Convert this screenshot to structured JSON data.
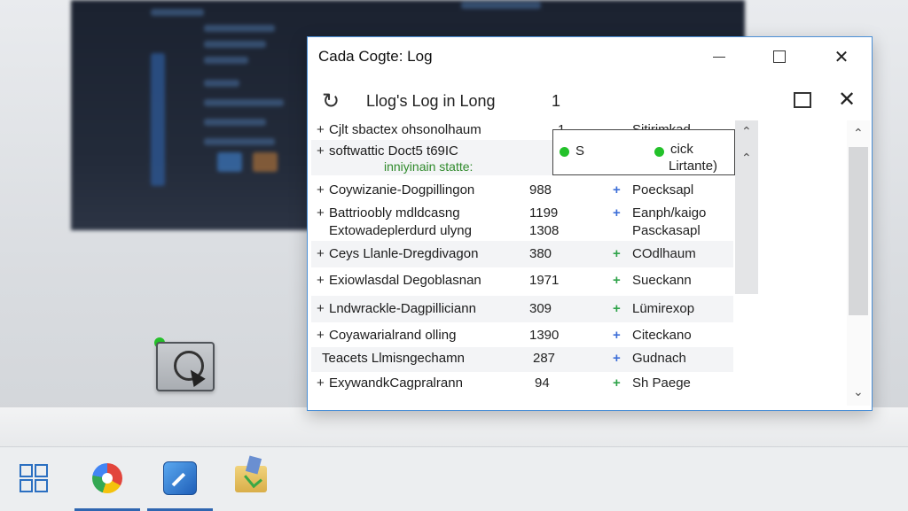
{
  "window": {
    "title": "Cada Cogte: Log",
    "controls": {
      "minimize": "—",
      "maximize": "☐",
      "close": "✕"
    }
  },
  "toolbar": {
    "refresh_icon": "↻",
    "title": "Llog's Log in Long",
    "count": "1",
    "close_icon": "✕"
  },
  "rows": [
    {
      "plus": "+",
      "name": "Cjlt sbactex ohsonolhaum",
      "count": "1",
      "mark": "",
      "status": "Sitirimkad"
    },
    {
      "plus": "+",
      "name": "softwattic Doct5 t69IC",
      "note": "inniyinain statte:",
      "count": "",
      "mark": "",
      "status": ""
    },
    {
      "plus": "+",
      "name": "Coywizanie-Dogpillingon",
      "count": "988",
      "mark": "+",
      "mark_color": "#3e6fd8",
      "status": "Poecksapl"
    },
    {
      "plus": "+",
      "name": "Battrioobly mdldcasng",
      "name2": "Extowadeplerdurd ulyng",
      "count": "1199",
      "count2": "1308",
      "mark": "+",
      "mark_color": "#3e6fd8",
      "status": "Eanph/kaigo",
      "status2": "Pasckasapl"
    },
    {
      "plus": "+",
      "name": "Ceys Llanle-Dregdivagon",
      "count": "380",
      "mark": "+",
      "mark_color": "#2fa34a",
      "status": "COdlhaum"
    },
    {
      "plus": "+",
      "name": "Exiowlasdal Degoblasnan",
      "count": "1971",
      "mark": "+",
      "mark_color": "#2fa34a",
      "status": "Sueckann"
    },
    {
      "plus": "+",
      "name": "Lndwrackle-Dagpilliciann",
      "count": "309",
      "mark": "+",
      "mark_color": "#2fa34a",
      "status": "Lümirexop"
    },
    {
      "plus": "+",
      "name": "Coyawarialrand olling",
      "count": "1390",
      "mark": "+",
      "mark_color": "#3e6fd8",
      "status": "Citeckano"
    },
    {
      "plus": "",
      "name": "Teacets Llmisngechamn",
      "count": "287",
      "mark": "+",
      "mark_color": "#3e6fd8",
      "status": "Gudnach"
    },
    {
      "plus": "+",
      "name": "ExywandkCagpralrann",
      "count": "94",
      "mark": "+",
      "mark_color": "#2fa34a",
      "status": "Sh Paege"
    }
  ],
  "popup": {
    "left_label": "S",
    "right_label": "cick",
    "right_sub": "Lirtante)"
  },
  "scroll": {
    "up": "⌃",
    "down": "⌄"
  },
  "taskbar": {
    "items": [
      "windows-start",
      "browser",
      "editor",
      "folder"
    ]
  },
  "colors": {
    "accent": "#4a8fd6",
    "green_status": "#25c02a",
    "note_green": "#2f8a2b"
  }
}
